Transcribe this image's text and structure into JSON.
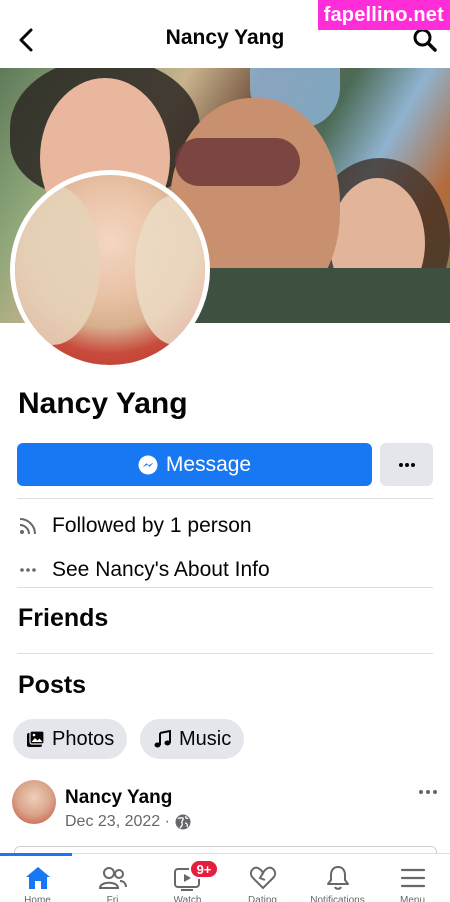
{
  "watermark": "fapellino.net",
  "topbar": {
    "title": "Nancy Yang",
    "back_icon": "chevron-left-icon",
    "search_icon": "search-icon"
  },
  "profile": {
    "name": "Nancy Yang",
    "message_label": "Message",
    "more_icon": "ellipsis-icon"
  },
  "info": {
    "followed_by": "Followed by 1 person",
    "about": "See Nancy's About Info"
  },
  "sections": {
    "friends": "Friends",
    "posts": "Posts"
  },
  "chips": [
    {
      "label": "Photos",
      "icon": "photo-icon"
    },
    {
      "label": "Music",
      "icon": "music-note-icon"
    }
  ],
  "post": {
    "author": "Nancy Yang",
    "date": "Dec 23, 2022 ·",
    "privacy_icon": "globe-icon"
  },
  "bottom_nav": {
    "tabs": [
      {
        "name": "home",
        "icon": "home-icon",
        "label": "Home",
        "active": true
      },
      {
        "name": "friends",
        "icon": "friends-icon",
        "label": "Fri"
      },
      {
        "name": "watch",
        "icon": "watch-icon",
        "label": "Watch",
        "badge": "9+"
      },
      {
        "name": "dating",
        "icon": "heart-icon",
        "label": "Dating"
      },
      {
        "name": "notifications",
        "icon": "bell-icon",
        "label": "Notifications"
      },
      {
        "name": "menu",
        "icon": "menu-icon",
        "label": "Menu"
      }
    ]
  },
  "colors": {
    "accent": "#1877f2",
    "badge": "#e41e3f",
    "watermark": "#ff2dd8",
    "chip_bg": "#e4e6eb"
  }
}
